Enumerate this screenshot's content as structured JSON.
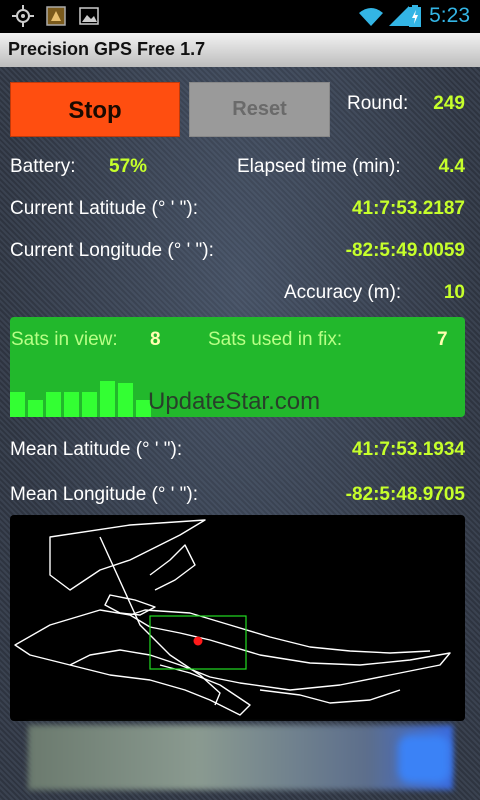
{
  "status_bar": {
    "time": "5:23",
    "icons": [
      "gps-icon",
      "notification-icon",
      "image-icon",
      "wifi-icon",
      "signal-icon",
      "battery-icon"
    ]
  },
  "title_bar": {
    "title": "Precision GPS Free  1.7"
  },
  "controls": {
    "stop_label": "Stop",
    "reset_label": "Reset",
    "round_label": "Round:",
    "round_value": "249"
  },
  "stats": {
    "battery_label": "Battery:",
    "battery_value": "57%",
    "elapsed_label": "Elapsed time (min):",
    "elapsed_value": "4.4",
    "cur_lat_label": "Current Latitude (° ' \"):",
    "cur_lat_value": "41:7:53.2187",
    "cur_lon_label": "Current Longitude (° ' \"):",
    "cur_lon_value": "-82:5:49.0059",
    "accuracy_label": "Accuracy (m):",
    "accuracy_value": "10"
  },
  "satellites": {
    "in_view_label": "Sats in view:",
    "in_view_value": "8",
    "used_label": "Sats used in fix:",
    "used_value": "7",
    "signal_bars": [
      0.45,
      0.3,
      0.45,
      0.45,
      0.45,
      0.65,
      0.6,
      0.3
    ]
  },
  "mean": {
    "lat_label": "Mean Latitude (° ' \"):",
    "lat_value": "41:7:53.1934",
    "lon_label": "Mean Longitude (° ' \"):",
    "lon_value": "-82:5:48.9705"
  },
  "watermark": "UpdateStar.com",
  "colors": {
    "stop": "#ff4e10",
    "reset": "#9a9a9a",
    "value": "#c6ff2b",
    "sat_panel": "#22b82c",
    "clock": "#33b5e5"
  }
}
